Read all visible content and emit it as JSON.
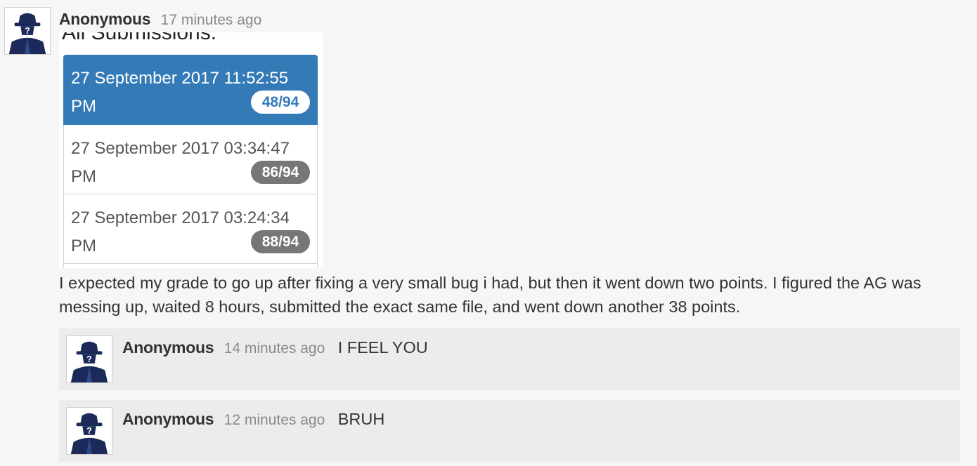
{
  "post": {
    "author": "Anonymous",
    "time": "17 minutes ago",
    "embed": {
      "title": "All Submissions:",
      "submissions": [
        {
          "date": "27 September 2017 11:52:55 PM",
          "score": "48/94",
          "active": true
        },
        {
          "date": "27 September 2017 03:34:47 PM",
          "score": "86/94",
          "active": false
        },
        {
          "date": "27 September 2017 03:24:34 PM",
          "score": "88/94",
          "active": false
        }
      ]
    },
    "body": "I expected my grade to go up after fixing a very small bug i had, but then it went down two points. I figured the AG was messing up, waited 8 hours, submitted the exact same file, and went down another 38 points."
  },
  "replies": [
    {
      "author": "Anonymous",
      "time": "14 minutes ago",
      "text": "I FEEL YOU"
    },
    {
      "author": "Anonymous",
      "time": "12 minutes ago",
      "text": "BRUH"
    }
  ],
  "colors": {
    "accent": "#337ab7",
    "badge": "#777777",
    "reply_bg": "#ececec",
    "avatar_figure": "#1c2a5a"
  },
  "icons": {
    "avatar": "anonymous-spy-avatar-icon"
  }
}
